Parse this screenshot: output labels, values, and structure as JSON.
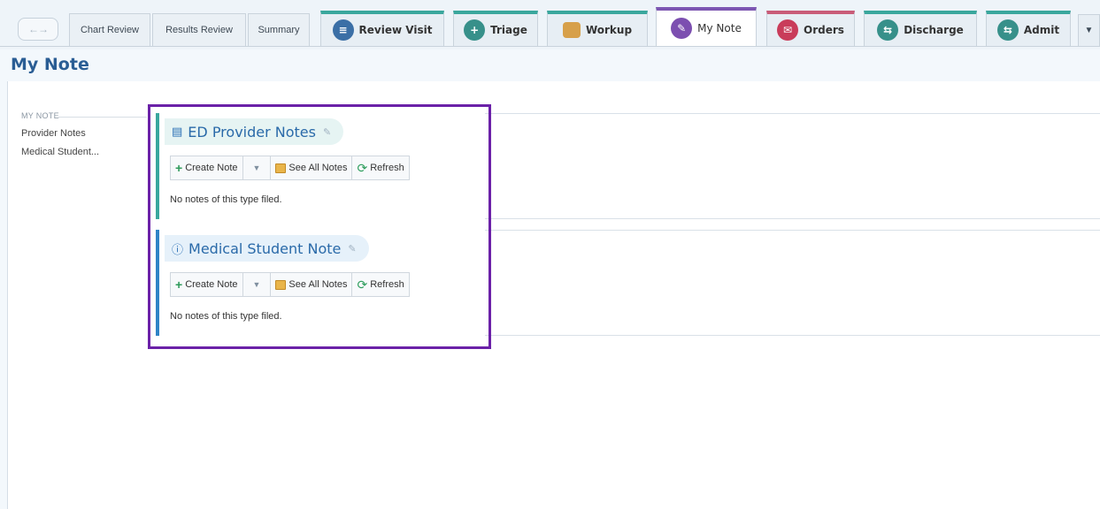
{
  "nav": {
    "arrows_label": "←→"
  },
  "tabs": {
    "chart_review": "Chart Review",
    "results_review": "Results Review",
    "summary": "Summary",
    "review_visit": "Review Visit",
    "triage": "Triage",
    "workup": "Workup",
    "my_note": "My Note",
    "orders": "Orders",
    "discharge": "Discharge",
    "admit": "Admit",
    "more": "▼"
  },
  "page": {
    "title": "My Note"
  },
  "left_nav": {
    "section_label": "MY NOTE",
    "items": [
      "Provider Notes",
      "Medical Student..."
    ]
  },
  "cards": [
    {
      "title": "ED Provider Notes",
      "create_label": "Create Note",
      "see_all_label": "See All Notes",
      "refresh_label": "Refresh",
      "empty_text": "No notes of this type filed."
    },
    {
      "title": "Medical Student Note",
      "create_label": "Create Note",
      "see_all_label": "See All Notes",
      "refresh_label": "Refresh",
      "empty_text": "No notes of this type filed."
    }
  ],
  "colors": {
    "accent_teal": "#3aa79d",
    "accent_blue": "#2f84c6",
    "title_blue": "#2a5d94",
    "highlight_purple": "#6b21a8",
    "orders_red": "#c95c78"
  }
}
